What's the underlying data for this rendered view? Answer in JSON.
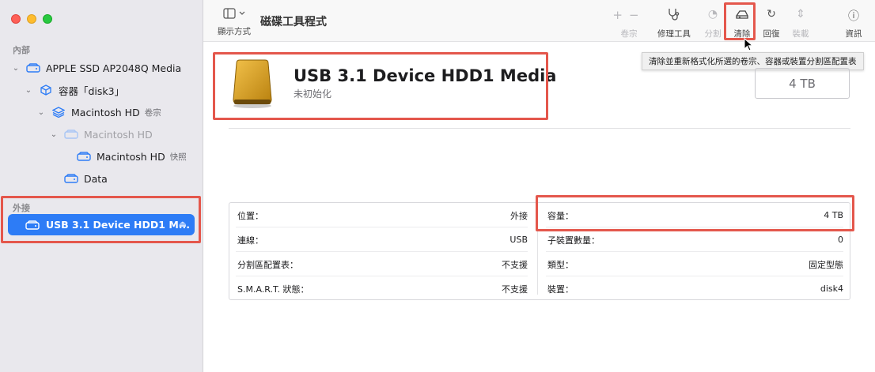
{
  "window": {
    "app_title": "磁碟工具程式",
    "view_label": "顯示方式"
  },
  "sidebar": {
    "internal_label": "內部",
    "external_label": "外接",
    "items": [
      {
        "label": "APPLE SSD AP2048Q Media",
        "suffix": ""
      },
      {
        "label": "容器「disk3」",
        "suffix": ""
      },
      {
        "label": "Macintosh HD",
        "suffix": "卷宗"
      },
      {
        "label": "Macintosh HD",
        "suffix": ""
      },
      {
        "label": "Macintosh HD",
        "suffix": "快照"
      },
      {
        "label": "Data",
        "suffix": ""
      }
    ],
    "selected": {
      "label": "USB 3.1 Device HDD1 M..."
    }
  },
  "toolbar": {
    "volume_label": "卷宗",
    "firstaid_label": "修理工具",
    "partition_label": "分割",
    "erase_label": "清除",
    "restore_label": "回復",
    "mount_label": "裝載",
    "info_label": "資訊"
  },
  "tooltip": {
    "text": "清除並重新格式化所選的卷宗、容器或裝置分割區配置表"
  },
  "disk": {
    "name": "USB 3.1 Device HDD1 Media",
    "status": "未初始化",
    "capacity_box": "4 TB"
  },
  "info": {
    "left": [
      {
        "key": "位置：",
        "value": "外接"
      },
      {
        "key": "連線：",
        "value": "USB"
      },
      {
        "key": "分割區配置表：",
        "value": "不支援"
      },
      {
        "key": "S.M.A.R.T. 狀態：",
        "value": "不支援"
      }
    ],
    "right": [
      {
        "key": "容量：",
        "value": "4 TB"
      },
      {
        "key": "子裝置數量：",
        "value": "0"
      },
      {
        "key": "類型：",
        "value": "固定型態"
      },
      {
        "key": "裝置：",
        "value": "disk4"
      }
    ]
  },
  "colors": {
    "accent": "#2d7cf6",
    "highlight": "#e4574c",
    "disk_gold": "#d9a21b"
  }
}
